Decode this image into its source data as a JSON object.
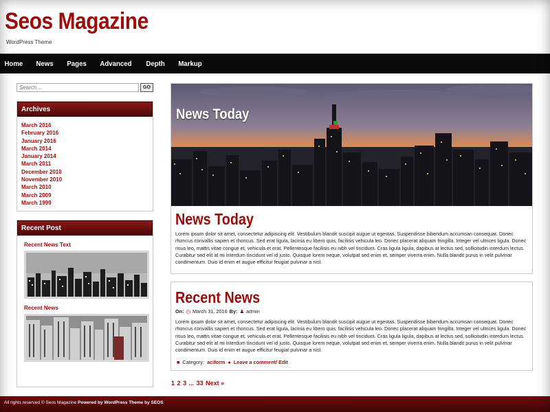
{
  "site": {
    "title": "Seos Magazine",
    "description": "WordPress Theme"
  },
  "nav": {
    "items": [
      "Home",
      "News",
      "Pages",
      "Advanced",
      "Depth",
      "Markup"
    ]
  },
  "search": {
    "placeholder": "Search ...",
    "button_label": "GO"
  },
  "archives": {
    "title": "Archives",
    "items": [
      "March 2016",
      "February 2016",
      "January 2016",
      "March 2014",
      "January 2014",
      "March 2011",
      "December 2010",
      "November 2010",
      "March 2010",
      "March 2009",
      "March 1999"
    ]
  },
  "recent_posts": {
    "title": "Recent Post",
    "items": [
      {
        "title": "Recent News Text"
      },
      {
        "title": "Recent News"
      }
    ]
  },
  "featured_post": {
    "image_caption": "News Today",
    "title": "News Today",
    "excerpt": "Lorem ipsum dolor sit amet, consectetur adipiscing elit. Vestibulum blandit suscipit augue ut egestas. Suspendisse bibendum accumsan consequat. Donec rhoncus convallis sapien et rhoncus. Sed erat ligula, lacinia eu libero quis, facilisis vehicula leo. Donec placerat aliquam fringilla. Integer vel ultrices ligula. Donec risus leo, mattis vitae congue et, vehicula et erat. Pellentesque facilisis eu nibh vel tincidunt. Cras ligula ligula, dapibus at lectus sed, sollicitudin interdum lectus. Curabitur sed elit at mi interdum tincidunt vel id justo. Quisque lorem neque, volutpat sed enim et, semper viverra enim. Nulla blandit purus in velit pulvinar condimentum. Duis id enim et augue efficitur feugiat pulvinar a nisl."
  },
  "second_post": {
    "title": "Recent News",
    "meta_on_label": "On:",
    "date": "March 31, 2016",
    "meta_by_label": "By:",
    "author": "admin",
    "excerpt": "Lorem ipsum dolor sit amet, consectetur adipiscing elit. Vestibulum blandit suscipit augue ut egestas. Suspendisse bibendum accumsan consequat. Donec rhoncus convallis sapien et rhoncus. Sed erat ligula, lacinia eu libero quis, facilisis vehicula leo. Donec placerat aliquam fringilla. Integer vel ultrices ligula. Donec risus leo, mattis vitae congue et, vehicula et erat. Pellentesque facilisis eu nibh vel tincidunt. Cras ligula ligula, dapibus at lectus sed, sollicitudin interdum lectus. Curabitur sed elit at mi interdum tincidunt vel id justo. Quisque lorem neque, volutpat sed enim et, semper viverra enim. Nulla blandit purus in velit pulvinar condimentum. Duis id enim et augue efficitur feugiat pulvinar a nisl.",
    "category_label": "Category:",
    "category": "aciform",
    "comment_link": "Leave a comment",
    "edit_link": "/ Edit"
  },
  "pagination": {
    "pages": [
      "1",
      "2",
      "3",
      "...",
      "33"
    ],
    "next_label": "Next »"
  },
  "footer": {
    "rights": "All rights reserved © Seos Magazine",
    "powered": "Powered by WordPress Theme by SEOS"
  },
  "colors": {
    "accent": "#9b0c0c",
    "nav_bg": "#0b0b0b",
    "footer_bg": "#5a0808"
  }
}
